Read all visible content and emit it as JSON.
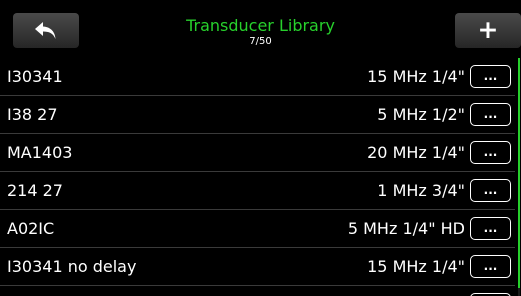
{
  "header": {
    "title": "Transducer Library",
    "counter": "7/50",
    "back_icon": "back-arrow-icon",
    "add_icon": "plus-icon",
    "add_label": "+",
    "title_color": "#27d02c"
  },
  "transducers": [
    {
      "name": "I30341",
      "spec": "15 MHz  1/4\"",
      "more_label": "..."
    },
    {
      "name": "I38 27",
      "spec": "5 MHz  1/2\"",
      "more_label": "..."
    },
    {
      "name": "MA1403",
      "spec": "20 MHz  1/4\"",
      "more_label": "..."
    },
    {
      "name": "214 27",
      "spec": "1 MHz  3/4\"",
      "more_label": "..."
    },
    {
      "name": "A02IC",
      "spec": "5 MHz  1/4\"  HD",
      "more_label": "..."
    },
    {
      "name": "I30341 no delay",
      "spec": "15 MHz  1/4\"",
      "more_label": "..."
    }
  ],
  "colors": {
    "background": "#000000",
    "accent": "#27d02c",
    "text": "#ffffff"
  }
}
